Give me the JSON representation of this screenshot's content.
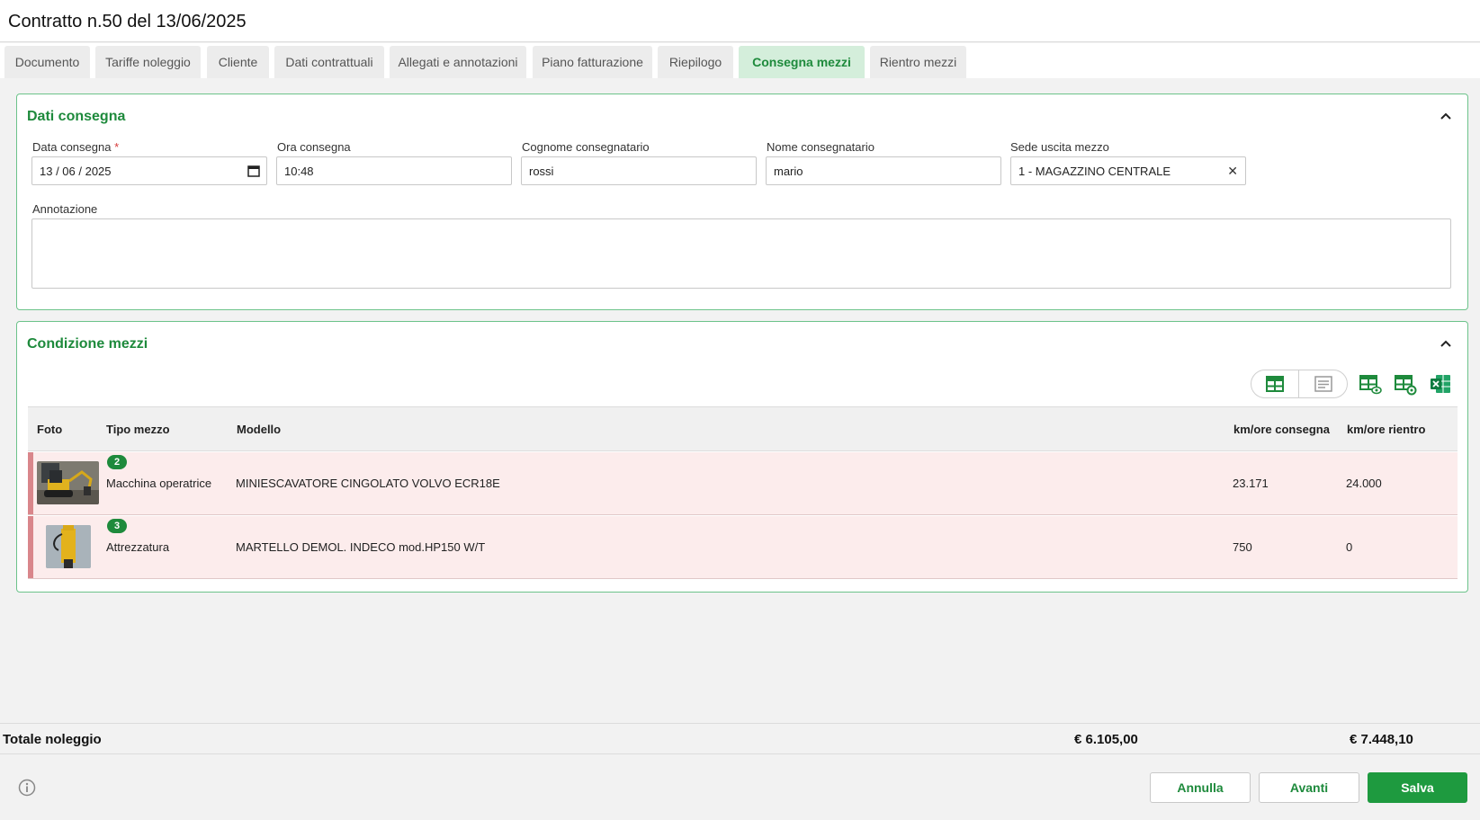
{
  "header": {
    "title": "Contratto n.50 del 13/06/2025"
  },
  "tabs": [
    {
      "label": "Documento",
      "active": false
    },
    {
      "label": "Tariffe noleggio",
      "active": false
    },
    {
      "label": "Cliente",
      "active": false
    },
    {
      "label": "Dati contrattuali",
      "active": false
    },
    {
      "label": "Allegati e annotazioni",
      "active": false
    },
    {
      "label": "Piano fatturazione",
      "active": false
    },
    {
      "label": "Riepilogo",
      "active": false
    },
    {
      "label": "Consegna mezzi",
      "active": true
    },
    {
      "label": "Rientro mezzi",
      "active": false
    }
  ],
  "delivery": {
    "title": "Dati consegna",
    "date": {
      "label": "Data consegna",
      "required_mark": "*",
      "value": "13 / 06 / 2025"
    },
    "time": {
      "label": "Ora consegna",
      "value": "10:48"
    },
    "surname": {
      "label": "Cognome consegnatario",
      "value": "rossi"
    },
    "name": {
      "label": "Nome consegnatario",
      "value": "mario"
    },
    "site": {
      "label": "Sede uscita mezzo",
      "value": "1 - MAGAZZINO CENTRALE",
      "clear": "✕"
    },
    "note": {
      "label": "Annotazione",
      "value": ""
    }
  },
  "conditions": {
    "title": "Condizione mezzi",
    "columns": {
      "photo": "Foto",
      "type": "Tipo mezzo",
      "model": "Modello",
      "km_out": "km/ore consegna",
      "km_in": "km/ore rientro"
    },
    "rows": [
      {
        "photo_count": "2",
        "type": "Macchina operatrice",
        "model": "MINIESCAVATORE CINGOLATO VOLVO ECR18E",
        "km_out": "23.171",
        "km_in": "24.000"
      },
      {
        "photo_count": "3",
        "type": "Attrezzatura",
        "model": "MARTELLO DEMOL. INDECO mod.HP150 W/T",
        "km_out": "750",
        "km_in": "0"
      }
    ],
    "icons": [
      "table-view-icon",
      "list-view-icon",
      "table-visibility-icon",
      "table-settings-icon",
      "excel-export-icon"
    ]
  },
  "totals": {
    "label": "Totale noleggio",
    "value1": "€ 6.105,00",
    "value2": "€ 7.448,10"
  },
  "footer": {
    "cancel": "Annulla",
    "next": "Avanti",
    "save": "Salva"
  },
  "colors": {
    "accent": "#1e8a3c",
    "row_highlight": "#fcecec",
    "row_stripe": "#d9868b"
  }
}
